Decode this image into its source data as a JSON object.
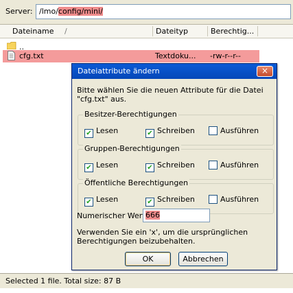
{
  "server": {
    "label": "Server:",
    "path_prefix": "/lmo/",
    "path_highlight": "config/mini/"
  },
  "file_list": {
    "columns": [
      "Dateiname",
      "Dateityp",
      "Berechtig..."
    ],
    "sort_indicator": "/",
    "rows": [
      {
        "name": "..",
        "type": "",
        "permissions": "",
        "icon": "folder-icon"
      },
      {
        "name": "cfg.txt",
        "type": "Textdoku...",
        "permissions": "-rw-r--r--",
        "icon": "text-file-icon"
      }
    ]
  },
  "status": {
    "text": "Selected 1 file. Total size: 87 B"
  },
  "dialog": {
    "title": "Dateiattribute ändern",
    "close": "×",
    "intro": "Bitte wählen Sie die neuen Attribute für die Datei \"cfg.txt\" aus.",
    "groups": [
      {
        "legend": "Besitzer-Berechtigungen",
        "read": "Lesen",
        "write": "Schreiben",
        "execute": "Ausführen",
        "read_checked": true,
        "write_checked": true,
        "execute_checked": false
      },
      {
        "legend": "Gruppen-Berechtigungen",
        "read": "Lesen",
        "write": "Schreiben",
        "execute": "Ausführen",
        "read_checked": true,
        "write_checked": true,
        "execute_checked": false
      },
      {
        "legend": "Öffentliche Berechtigungen",
        "read": "Lesen",
        "write": "Schreiben",
        "execute": "Ausführen",
        "read_checked": true,
        "write_checked": true,
        "execute_checked": false
      }
    ],
    "numeric_label": "Numerischer Wert:",
    "numeric_value": "666",
    "hint": "Verwenden Sie ein 'x', um die ursprünglichen Berechtigungen beizubehalten.",
    "ok_label": "OK",
    "cancel_label": "Abbrechen"
  },
  "colors": {
    "highlight": "#f08c8c",
    "titlebar": "#0a5ad6",
    "dialog_bg": "#ece9d8"
  }
}
